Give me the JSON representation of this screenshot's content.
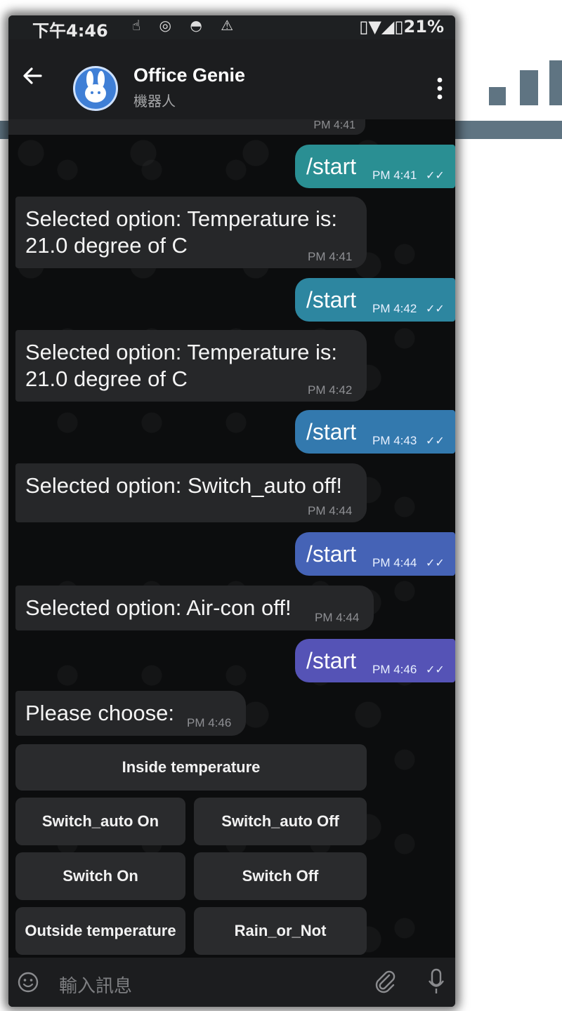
{
  "status_bar": {
    "time": "下午4:46",
    "notification_icons": "☝ ◎ ◓ ⚠",
    "right": "▯▼◢▯21%"
  },
  "header": {
    "title": "Office Genie",
    "subtitle": "機器人"
  },
  "chat": {
    "top_stub_time": "PM 4:41",
    "messages": [
      {
        "direction": "out",
        "text": "/start",
        "time": "PM 4:41",
        "status": "✓✓"
      },
      {
        "direction": "in",
        "lines": [
          "Selected option: Temperature is:",
          "21.0 degree of C"
        ],
        "time": "PM 4:41"
      },
      {
        "direction": "out",
        "text": "/start",
        "time": "PM 4:42",
        "status": "✓✓"
      },
      {
        "direction": "in",
        "lines": [
          "Selected option: Temperature is:",
          "21.0 degree of C"
        ],
        "time": "PM 4:42"
      },
      {
        "direction": "out",
        "text": "/start",
        "time": "PM 4:43",
        "status": "✓✓"
      },
      {
        "direction": "in",
        "lines": [
          "Selected option: Switch_auto off!"
        ],
        "time": "PM 4:44"
      },
      {
        "direction": "out",
        "text": "/start",
        "time": "PM 4:44",
        "status": "✓✓"
      },
      {
        "direction": "in",
        "lines": [
          "Selected option: Air-con off!"
        ],
        "time": "PM 4:44"
      },
      {
        "direction": "out",
        "text": "/start",
        "time": "PM 4:46",
        "status": "✓✓"
      },
      {
        "direction": "in",
        "lines": [
          "Please choose:"
        ],
        "time": "PM 4:46"
      }
    ]
  },
  "keyboard": {
    "rows": [
      [
        "Inside temperature"
      ],
      [
        "Switch_auto On",
        "Switch_auto Off"
      ],
      [
        "Switch On",
        "Switch Off"
      ],
      [
        "Outside temperature",
        "Rain_or_Not"
      ]
    ]
  },
  "input": {
    "placeholder": "輸入訊息"
  },
  "colors": {
    "outgoing_bubbles": [
      "#2a8f93",
      "#2d86a0",
      "#3379ae",
      "#4563b6",
      "#5553b6"
    ],
    "incoming_bubble": "#262729",
    "decoration": "#5f7482"
  }
}
